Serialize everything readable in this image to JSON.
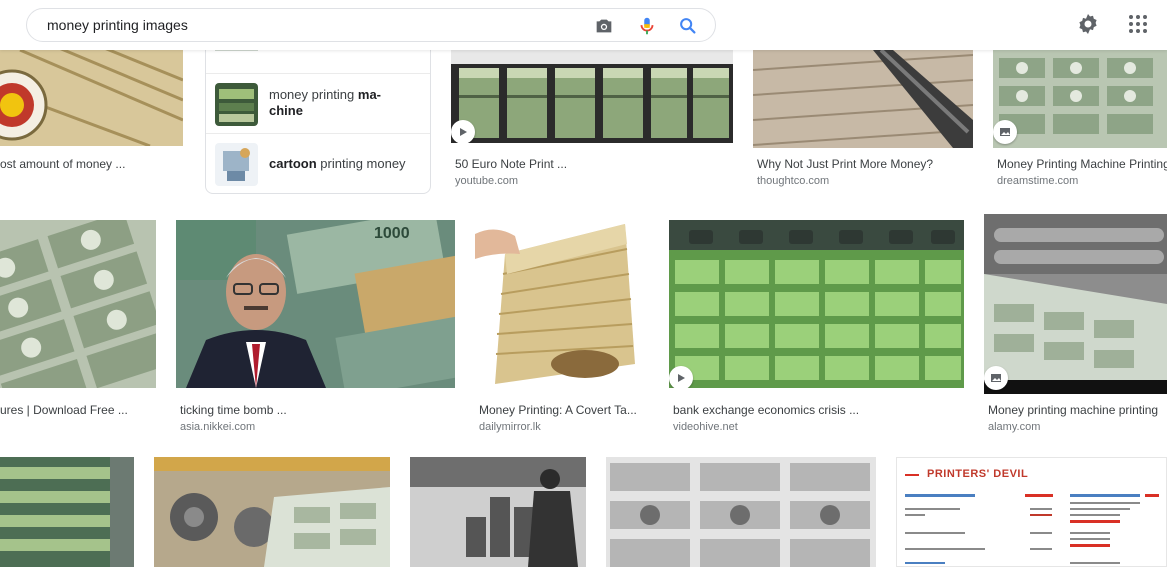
{
  "search": {
    "query": "money printing images"
  },
  "related": {
    "items": [
      {
        "normal": "money printing ",
        "bold": "ma-",
        "bold2": "chine"
      },
      {
        "bold": "cartoon",
        "normal": " printing money"
      }
    ]
  },
  "results": [
    {
      "caption": "ost amount of money ...",
      "source": ""
    },
    {
      "caption": "50 Euro Note Print ...",
      "source": "youtube.com"
    },
    {
      "caption": "Why Not Just Print More Money?",
      "source": "thoughtco.com"
    },
    {
      "caption": "Money Printing Machine Printing",
      "source": "dreamstime.com"
    },
    {
      "caption": "ures | Download Free ...",
      "source": ""
    },
    {
      "caption": "ticking time bomb ...",
      "source": "asia.nikkei.com"
    },
    {
      "caption": "Money Printing: A Covert Ta...",
      "source": "dailymirror.lk"
    },
    {
      "caption": "bank exchange economics crisis ...",
      "source": "videohive.net"
    },
    {
      "caption": "Money printing machine printing",
      "source": "alamy.com"
    }
  ],
  "thumb_texts": {
    "printers_devil": "PRINTERS' DEVIL",
    "banknote_1000": "1000"
  },
  "colors": {
    "accent_blue": "#4285f4",
    "mic_red": "#ea4335",
    "caption_gray": "#3c4043",
    "source_gray": "#70757a"
  }
}
